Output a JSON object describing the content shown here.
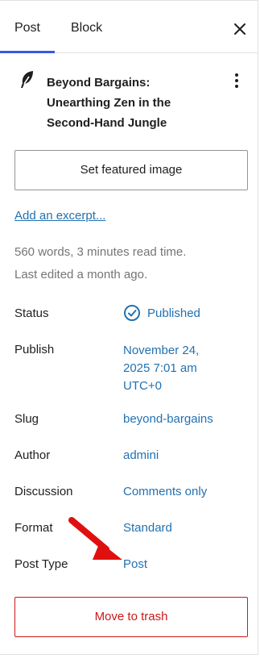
{
  "tabs": {
    "post": "Post",
    "block": "Block"
  },
  "post": {
    "title": "Beyond Bargains: Unearthing Zen in the Second-Hand Jungle",
    "featured_image_label": "Set featured image",
    "excerpt_link": "Add an excerpt...",
    "stats": "560 words, 3 minutes read time.",
    "last_edited": "Last edited a month ago."
  },
  "fields": {
    "status": {
      "label": "Status",
      "value": "Published"
    },
    "publish": {
      "label": "Publish",
      "line1": "November 24,",
      "line2": "2025 7:01 am",
      "line3": "UTC+0"
    },
    "slug": {
      "label": "Slug",
      "value": "beyond-bargains"
    },
    "author": {
      "label": "Author",
      "value": "admini"
    },
    "discussion": {
      "label": "Discussion",
      "value": "Comments only"
    },
    "format": {
      "label": "Format",
      "value": "Standard"
    },
    "post_type": {
      "label": "Post Type",
      "value": "Post"
    }
  },
  "trash_label": "Move to trash",
  "colors": {
    "link": "#2271b1",
    "danger": "#cc1818",
    "accent": "#3858e9",
    "arrow": "#e01010"
  },
  "icons": [
    "feather-icon",
    "close-icon",
    "more-vertical-icon",
    "check-circle-icon",
    "red-arrow-annotation"
  ]
}
